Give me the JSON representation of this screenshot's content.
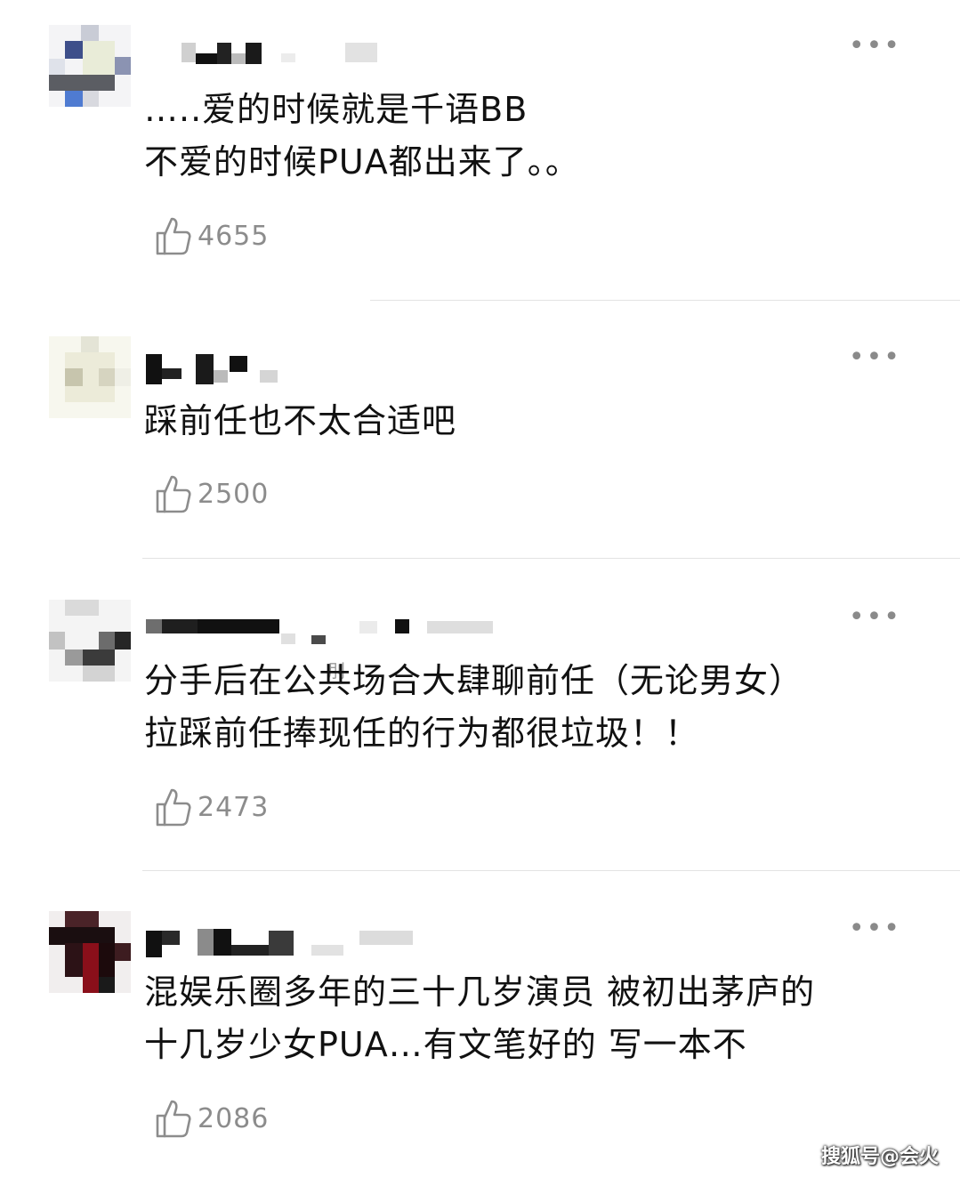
{
  "comments": [
    {
      "lines": [
        "…..爱的时候就是千语BB",
        "不爱的时候PUA都出来了。。"
      ],
      "likes": "4655"
    },
    {
      "lines": [
        "踩前任也不太合适吧"
      ],
      "likes": "2500"
    },
    {
      "lines": [
        "分手后在公共场合大肆聊前任（无论男女）",
        "拉踩前任捧现任的行为都很垃圾！！"
      ],
      "likes": "2473"
    },
    {
      "lines": [
        "混娱乐圈多年的三十几岁演员 被初出茅庐的",
        "十几岁少女PUA…有文笔好的 写一本不"
      ],
      "likes": "2086"
    }
  ],
  "more_icon": "more-dots-icon",
  "like_icon": "thumbs-up-icon",
  "partial_label": "刖",
  "watermark": "搜狐号@会火",
  "colors": {
    "text": "#111111",
    "meta": "#8c8c8c",
    "divider": "#e3e3e3"
  }
}
